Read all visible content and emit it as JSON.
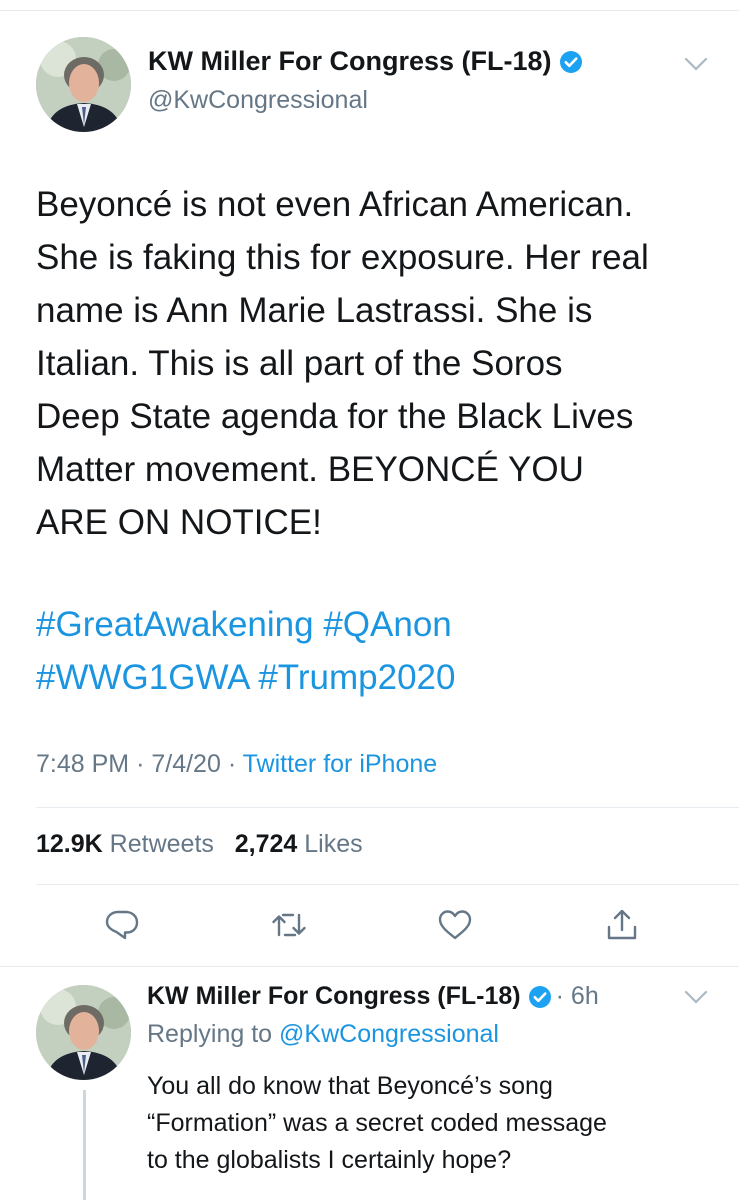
{
  "tweet": {
    "author_name": "KW Miller For Congress (FL-18)",
    "author_handle": "@KwCongressional",
    "text_lines": [
      "Beyoncé is not even African American.",
      "She is faking this for exposure. Her real",
      "name is Ann Marie Lastrassi. She is",
      "Italian. This is all part of the Soros",
      "Deep State agenda for the Black Lives",
      "Matter movement. BEYONCÉ YOU",
      "ARE ON NOTICE!"
    ],
    "hashtag_lines": [
      "#GreatAwakening #QAnon",
      "#WWG1GWA #Trump2020"
    ],
    "time": "7:48 PM",
    "date": "7/4/20",
    "separator": "·",
    "source": "Twitter for iPhone",
    "retweets_count": "12.9K",
    "retweets_label": "Retweets",
    "likes_count": "2,724",
    "likes_label": "Likes"
  },
  "icons": {
    "reply": "reply-icon",
    "retweet": "retweet-icon",
    "like": "heart-icon",
    "share": "share-icon",
    "verified": "verified-badge-icon",
    "menu": "chevron-down-icon"
  },
  "reply_tweet": {
    "author_name": "KW Miller For Congress (FL-18)",
    "age": "· 6h",
    "replying_to_label": "Replying to",
    "replying_to_handle": "@KwCongressional",
    "text_lines": [
      "You all do know that Beyoncé’s song",
      "“Formation” was a secret coded message",
      "to the globalists I certainly hope?"
    ]
  },
  "colors": {
    "link": "#1b95e0",
    "secondary_text": "#657786",
    "primary_text": "#14171a",
    "divider": "#e6ecf0"
  }
}
